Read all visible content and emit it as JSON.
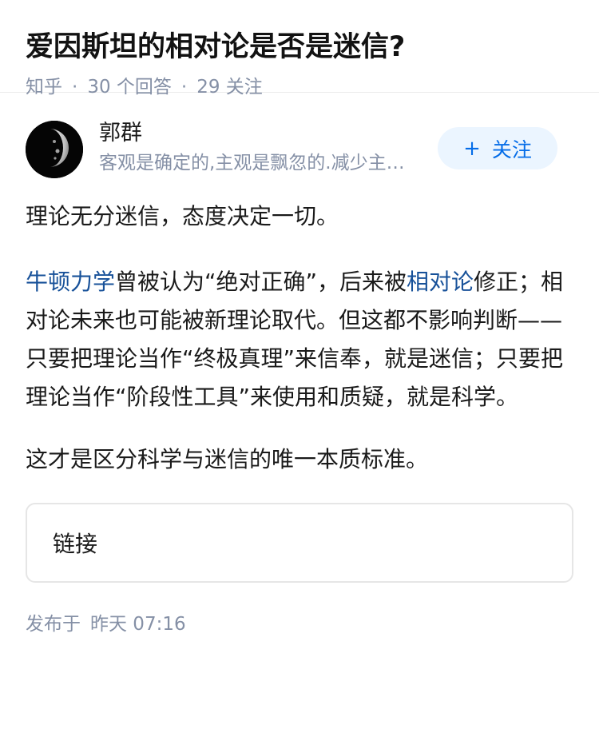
{
  "question": {
    "title": "爱因斯坦的相对论是否是迷信?",
    "source": "知乎",
    "separator": "·",
    "answers_count": "30 个回答",
    "followers_count": "29 关注"
  },
  "author": {
    "name": "郭群",
    "bio": "客观是确定的,主观是飘忽的.减少主观因素",
    "follow_label": "关注",
    "follow_icon": "plus-icon"
  },
  "answer": {
    "p1": "理论无分迷信，态度决定一切。",
    "p2": {
      "link1": "牛顿力学",
      "text1": "曾被认为“绝对正确”，后来被",
      "link2": "相对论",
      "text2": "修正；相对论未来也可能被新理论取代。但这都不影响判断——只要把理论当作“终极真理”来信奉，就是迷信；只要把理论当作“阶段性工具”来使用和质疑，就是科学。"
    },
    "p3": "这才是区分科学与迷信的唯一本质标准。",
    "link_card_label": "链接"
  },
  "publish": {
    "label": "发布于",
    "time": "昨天 07:16"
  },
  "colors": {
    "link": "#175199",
    "accent": "#056de8",
    "meta": "#8590a6",
    "follow_bg": "#ebf5ff"
  }
}
